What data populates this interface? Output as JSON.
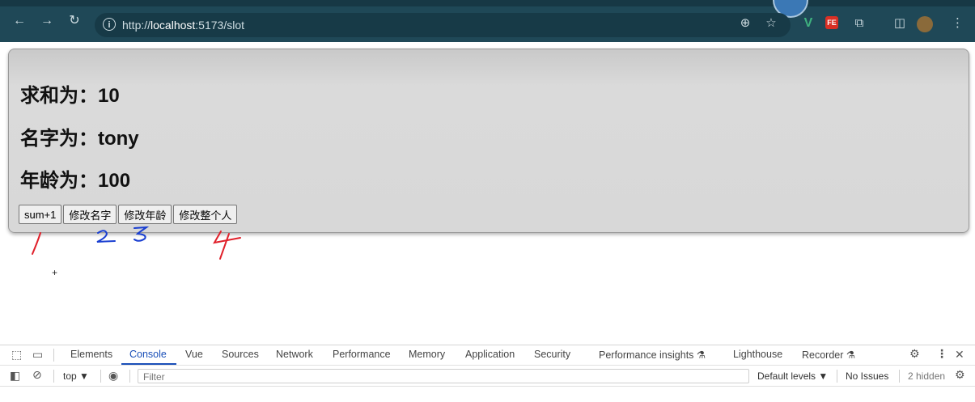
{
  "browser": {
    "url_prefix": "http://",
    "url_host": "localhost",
    "url_rest": ":5173/slot",
    "icons": {
      "back": "←",
      "forward": "→",
      "reload": "↻",
      "info": "i",
      "zoom": "⊕",
      "bookmark": "☆",
      "vue_ext": "V",
      "fe_ext": "FE",
      "extensions": "⧉",
      "sidebar": "◫",
      "menu": "⋮"
    }
  },
  "page": {
    "sum_line": "求和为：10",
    "name_line": "名字为：tony",
    "age_line": "年龄为：100",
    "buttons": {
      "sum": "sum+1",
      "change_name": "修改名字",
      "change_age": "修改年龄",
      "change_person": "修改整个人"
    },
    "plus_mark": "+"
  },
  "devtools": {
    "icons": {
      "inspect": "⬚",
      "device": "▭",
      "settings": "⚙",
      "more": "⋮",
      "close": "✕",
      "sidebar_toggle": "◧",
      "clear": "⊘",
      "eye": "◉",
      "issues_gear": "⚙"
    },
    "tabs": [
      "Elements",
      "Console",
      "Vue",
      "Sources",
      "Network",
      "Performance",
      "Memory",
      "Application",
      "Security",
      "Performance insights ⚗",
      "Lighthouse",
      "Recorder ⚗"
    ],
    "context": "top ▼",
    "filter_placeholder": "Filter",
    "default_levels": "Default levels ▼",
    "no_issues": "No Issues",
    "hidden_count": "2 hidden"
  }
}
